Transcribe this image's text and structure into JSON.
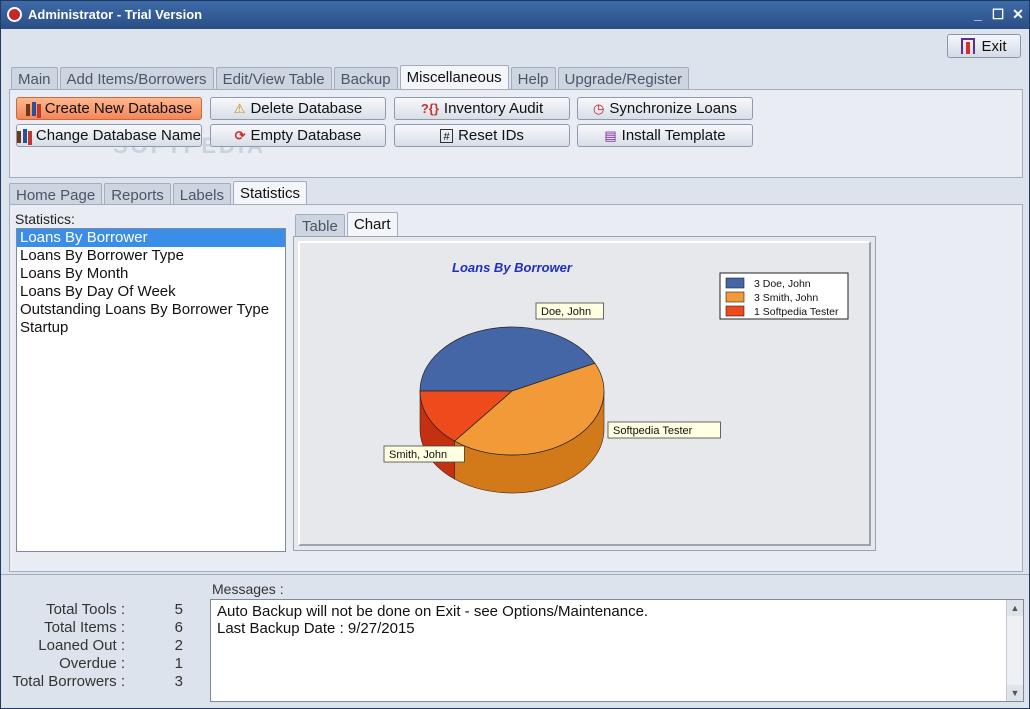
{
  "window": {
    "title": "Administrator - Trial Version",
    "min": "_",
    "max": "☐",
    "close": "✕"
  },
  "exit_label": "Exit",
  "main_tabs": [
    "Main",
    "Add Items/Borrowers",
    "Edit/View Table",
    "Backup",
    "Miscellaneous",
    "Help",
    "Upgrade/Register"
  ],
  "main_tab_active": "Miscellaneous",
  "toolbar": {
    "create_db": "Create New Database",
    "delete_db": "Delete Database",
    "inventory_audit": "Inventory Audit",
    "sync_loans": "Synchronize Loans",
    "change_db_name": "Change Database Name",
    "empty_db": "Empty Database",
    "reset_ids": "Reset IDs",
    "install_template": "Install Template"
  },
  "watermark": "SOFTPEDIA",
  "sub_tabs": [
    "Home Page",
    "Reports",
    "Labels",
    "Statistics"
  ],
  "sub_tab_active": "Statistics",
  "statistics_label": "Statistics:",
  "statistics_list": [
    "Loans By Borrower",
    "Loans By Borrower Type",
    "Loans By Month",
    "Loans By Day Of Week",
    "Outstanding Loans By Borrower Type",
    "Startup"
  ],
  "selected_statistic": "Loans By Borrower",
  "view_tabs": [
    "Table",
    "Chart"
  ],
  "view_tab_active": "Chart",
  "chart_data": {
    "type": "pie",
    "title": "Loans By Borrower",
    "categories": [
      "Doe, John",
      "Smith, John",
      "Softpedia Tester"
    ],
    "values": [
      3,
      3,
      1
    ],
    "legend": [
      "3 Doe, John",
      "3 Smith, John",
      "1 Softpedia Tester"
    ],
    "colors": [
      "#4466a6",
      "#f29a38",
      "#ee4b1c"
    ],
    "side_colors": [
      "#2e4f86",
      "#d27a1a",
      "#c43010"
    ],
    "legend_position": "top-right",
    "three_d": true
  },
  "messages_label": "Messages :",
  "messages": [
    "Auto Backup will not be done on Exit - see Options/Maintenance.",
    "Last Backup Date : 9/27/2015"
  ],
  "summary": [
    {
      "label": "Total Tools :",
      "value": "5"
    },
    {
      "label": "Total Items :",
      "value": "6"
    },
    {
      "label": "Loaned Out :",
      "value": "2"
    },
    {
      "label": "Overdue :",
      "value": "1"
    },
    {
      "label": "Total Borrowers :",
      "value": "3"
    }
  ]
}
